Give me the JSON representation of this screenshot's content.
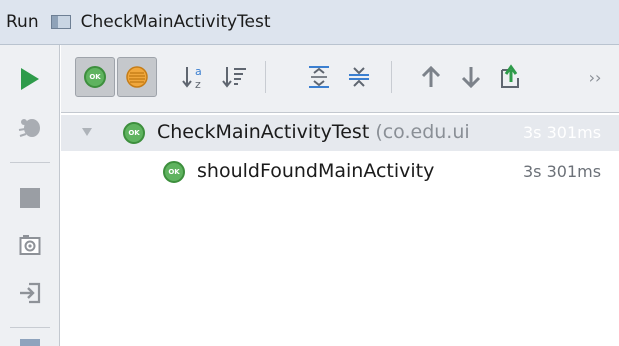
{
  "titlebar": {
    "run_label": "Run",
    "config_icon": "run-config-icon",
    "config_name": "CheckMainActivityTest"
  },
  "left_toolbar": {
    "items": [
      "run-icon",
      "debug-icon",
      "stop-icon",
      "camera-icon",
      "login-icon"
    ]
  },
  "top_toolbar": {
    "ok_badge_text": "OK",
    "more_label": "››",
    "items": [
      "show-passed-icon",
      "show-ignored-icon",
      "sort-alpha-icon",
      "sort-duration-icon",
      "expand-all-icon",
      "collapse-all-icon",
      "previous-icon",
      "next-icon",
      "export-icon"
    ]
  },
  "tree": {
    "root": {
      "badge": "OK",
      "name": "CheckMainActivityTest",
      "pkg": "(co.edu.ui",
      "time": "3s 301ms"
    },
    "child": {
      "badge": "OK",
      "name": "shouldFoundMainActivity",
      "time": "3s 301ms"
    }
  },
  "colors": {
    "titlebar_bg": "#dde4ee",
    "run_green": "#2e9b4a",
    "ok_green": "#5fb35f",
    "selected_time_color": "#ffffff"
  }
}
